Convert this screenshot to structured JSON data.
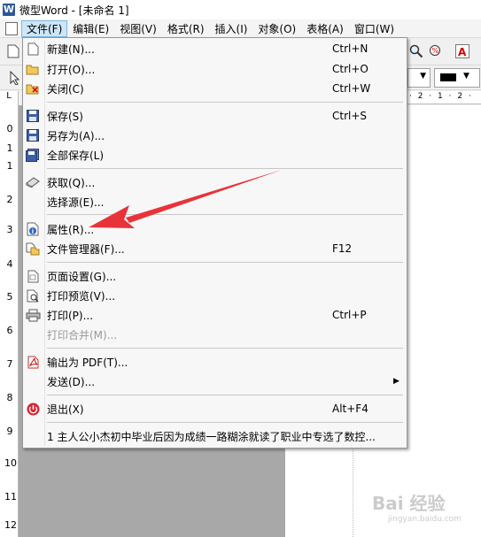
{
  "window": {
    "title": "微型Word - [未命名 1]"
  },
  "menubar": {
    "items": [
      {
        "label": "文件(F)",
        "active": true
      },
      {
        "label": "编辑(E)"
      },
      {
        "label": "视图(V)"
      },
      {
        "label": "格式(R)"
      },
      {
        "label": "插入(I)"
      },
      {
        "label": "对象(O)"
      },
      {
        "label": "表格(A)"
      },
      {
        "label": "窗口(W)"
      }
    ]
  },
  "ruler": {
    "h_marks": "· 2 · 1 · 2 ·",
    "v_numbers": [
      "0",
      "1",
      "1",
      "2",
      "3",
      "4",
      "5",
      "6",
      "7",
      "8",
      "9",
      "10",
      "11",
      "12"
    ]
  },
  "file_menu": {
    "items": [
      {
        "label": "新建(N)...",
        "shortcut": "Ctrl+N",
        "icon": "new-doc-icon"
      },
      {
        "label": "打开(O)...",
        "shortcut": "Ctrl+O",
        "icon": "folder-open-icon"
      },
      {
        "label": "关闭(C)",
        "shortcut": "Ctrl+W",
        "icon": "close-doc-icon"
      },
      {
        "label": "保存(S)",
        "shortcut": "Ctrl+S",
        "icon": "save-icon"
      },
      {
        "label": "另存为(A)...",
        "shortcut": "",
        "icon": "save-as-icon"
      },
      {
        "label": "全部保存(L)",
        "shortcut": "",
        "icon": "save-all-icon"
      },
      {
        "label": "获取(Q)...",
        "shortcut": "",
        "icon": "scanner-icon"
      },
      {
        "label": "选择源(E)...",
        "shortcut": ""
      },
      {
        "label": "属性(R)...",
        "shortcut": "",
        "icon": "info-icon"
      },
      {
        "label": "文件管理器(F)...",
        "shortcut": "F12",
        "icon": "file-manager-icon"
      },
      {
        "label": "页面设置(G)...",
        "shortcut": "",
        "icon": "page-setup-icon"
      },
      {
        "label": "打印预览(V)...",
        "shortcut": "",
        "icon": "print-preview-icon"
      },
      {
        "label": "打印(P)...",
        "shortcut": "Ctrl+P",
        "icon": "printer-icon"
      },
      {
        "label": "打印合并(M)...",
        "shortcut": "",
        "disabled": true
      },
      {
        "label": "输出为 PDF(T)...",
        "shortcut": "",
        "icon": "pdf-icon"
      },
      {
        "label": "发送(D)...",
        "shortcut": "",
        "submenu": true
      },
      {
        "label": "退出(X)",
        "shortcut": "Alt+F4",
        "icon": "exit-icon"
      },
      {
        "label": "1 主人公小杰初中毕业后因为成绩一路糊涂就读了职业中专选了数控...",
        "shortcut": ""
      }
    ]
  },
  "watermark": {
    "text": "Bai 经验",
    "sub": "jingyan.baidu.com"
  },
  "colors": {
    "arrow": "#e8333a",
    "menu_highlight": "#cde6f7",
    "canvas": "#a8a8a8"
  }
}
